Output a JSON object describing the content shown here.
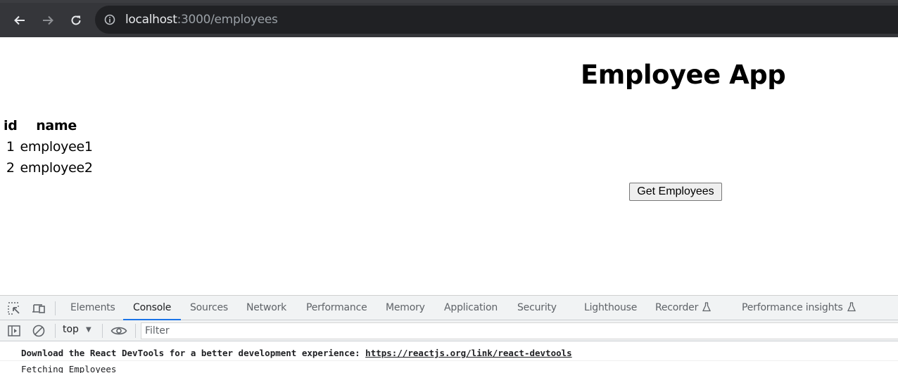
{
  "browser": {
    "url_host": "localhost",
    "url_rest": ":3000/employees",
    "icons": [
      "back-arrow-icon",
      "forward-arrow-icon",
      "reload-icon",
      "info-icon"
    ]
  },
  "page": {
    "title": "Employee App",
    "table": {
      "headers": [
        "id",
        "name"
      ],
      "rows": [
        {
          "id": "1",
          "name": "employee1"
        },
        {
          "id": "2",
          "name": "employee2"
        }
      ]
    },
    "get_button_label": "Get Employees"
  },
  "devtools": {
    "tabs": [
      {
        "label": "Elements",
        "active": false
      },
      {
        "label": "Console",
        "active": true
      },
      {
        "label": "Sources",
        "active": false
      },
      {
        "label": "Network",
        "active": false
      },
      {
        "label": "Performance",
        "active": false
      },
      {
        "label": "Memory",
        "active": false
      },
      {
        "label": "Application",
        "active": false
      },
      {
        "label": "Security",
        "active": false
      },
      {
        "label": "Lighthouse",
        "active": false
      },
      {
        "label": "Recorder",
        "active": false,
        "experimental": true
      },
      {
        "label": "Performance insights",
        "active": false,
        "experimental": true
      }
    ],
    "toolbar": {
      "context": "top",
      "filter_placeholder": "Filter",
      "filter_value": ""
    },
    "console": {
      "messages": [
        {
          "text": "Download the React DevTools for a better development experience: ",
          "link": "https://reactjs.org/link/react-devtools"
        },
        {
          "text": "Fetching Employees"
        }
      ]
    },
    "accent_color": "#1a73e8"
  }
}
